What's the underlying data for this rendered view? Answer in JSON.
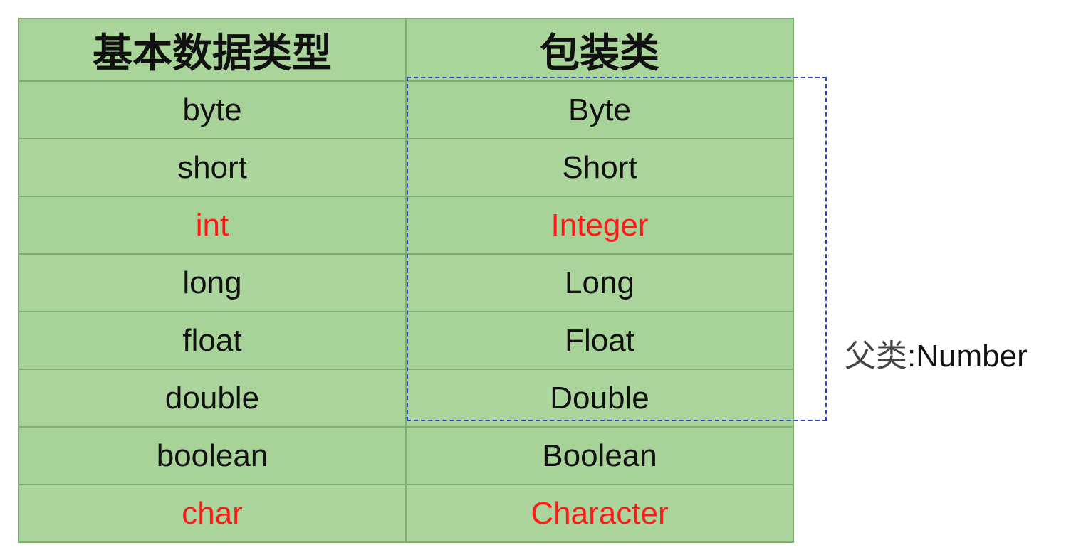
{
  "table": {
    "headers": [
      "基本数据类型",
      "包装类"
    ],
    "rows": [
      {
        "primitive": "byte",
        "wrapper": "Byte",
        "highlight": false
      },
      {
        "primitive": "short",
        "wrapper": "Short",
        "highlight": false
      },
      {
        "primitive": "int",
        "wrapper": "Integer",
        "highlight": true
      },
      {
        "primitive": "long",
        "wrapper": "Long",
        "highlight": false
      },
      {
        "primitive": "float",
        "wrapper": "Float",
        "highlight": false
      },
      {
        "primitive": "double",
        "wrapper": "Double",
        "highlight": false
      },
      {
        "primitive": "boolean",
        "wrapper": "Boolean",
        "highlight": false
      },
      {
        "primitive": "char",
        "wrapper": "Character",
        "highlight": true
      }
    ]
  },
  "annotation": {
    "prefix": "父类",
    "text": ":Number"
  },
  "colors": {
    "cell_background": "#a9d49a",
    "grid_line": "#7db06c",
    "highlight_text": "#ff1a1a",
    "dash_box": "#2b3fc9"
  }
}
